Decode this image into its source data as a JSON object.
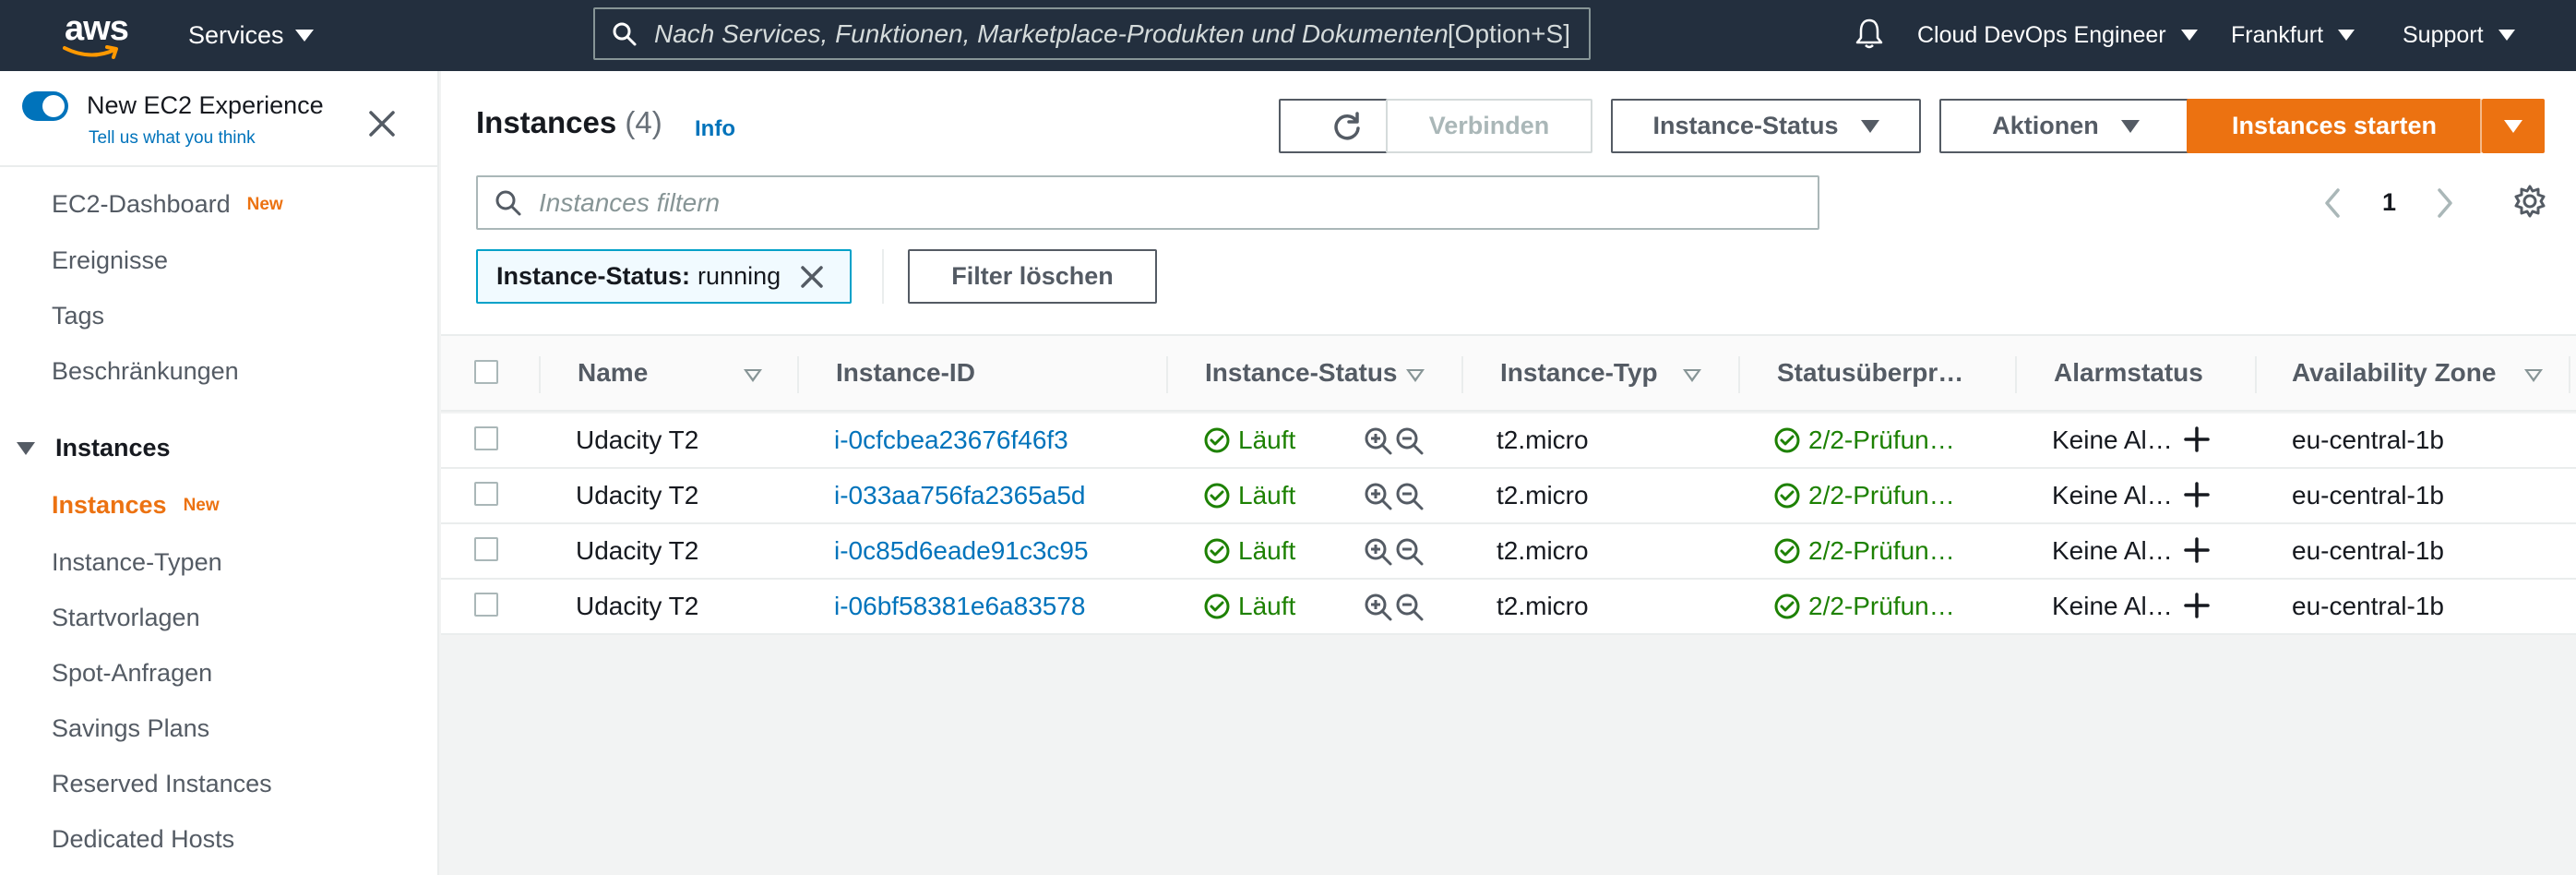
{
  "topnav": {
    "logo_text": "aws",
    "services_label": "Services",
    "search_placeholder": "Nach Services, Funktionen, Marketplace-Produkten und Dokumentenpfaden suchen",
    "search_shortcut": "[Option+S]",
    "account_label": "Cloud DevOps Engineer",
    "region_label": "Frankfurt",
    "support_label": "Support"
  },
  "sidebar": {
    "title": "New EC2 Experience",
    "feedback_link": "Tell us what you think",
    "items_top": [
      {
        "label": "EC2-Dashboard",
        "badge": "New"
      },
      {
        "label": "Ereignisse"
      },
      {
        "label": "Tags"
      },
      {
        "label": "Beschränkungen"
      }
    ],
    "section_title": "Instances",
    "items_section": [
      {
        "label": "Instances",
        "badge": "New",
        "active": true
      },
      {
        "label": "Instance-Typen"
      },
      {
        "label": "Startvorlagen"
      },
      {
        "label": "Spot-Anfragen"
      },
      {
        "label": "Savings Plans"
      },
      {
        "label": "Reserved Instances"
      },
      {
        "label": "Dedicated Hosts"
      }
    ]
  },
  "main": {
    "title": "Instances",
    "count": "(4)",
    "info_label": "Info",
    "connect_label": "Verbinden",
    "instance_state_label": "Instance-Status",
    "actions_label": "Aktionen",
    "launch_label": "Instances starten",
    "filter_placeholder": "Instances filtern",
    "page_number": "1",
    "filter_token": {
      "key": "Instance-Status:",
      "value": "running"
    },
    "clear_filter_label": "Filter löschen"
  },
  "table": {
    "columns": [
      "Name",
      "Instance-ID",
      "Instance-Status",
      "Instance-Typ",
      "Statusüberpr…",
      "Alarmstatus",
      "Availability Zone"
    ],
    "rows": [
      {
        "name": "Udacity T2",
        "id": "i-0cfcbea23676f46f3",
        "state": "Läuft",
        "type": "t2.micro",
        "check": "2/2-Prüfun…",
        "alarm": "Keine Al…",
        "az": "eu-central-1b"
      },
      {
        "name": "Udacity T2",
        "id": "i-033aa756fa2365a5d",
        "state": "Läuft",
        "type": "t2.micro",
        "check": "2/2-Prüfun…",
        "alarm": "Keine Al…",
        "az": "eu-central-1b"
      },
      {
        "name": "Udacity T2",
        "id": "i-0c85d6eade91c3c95",
        "state": "Läuft",
        "type": "t2.micro",
        "check": "2/2-Prüfun…",
        "alarm": "Keine Al…",
        "az": "eu-central-1b"
      },
      {
        "name": "Udacity T2",
        "id": "i-06bf58381e6a83578",
        "state": "Läuft",
        "type": "t2.micro",
        "check": "2/2-Prüfun…",
        "alarm": "Keine Al…",
        "az": "eu-central-1b"
      }
    ]
  },
  "colors": {
    "nav_bg": "#232f3e",
    "accent_orange": "#ec7211",
    "link_blue": "#0073bb",
    "success_green": "#1d8102"
  }
}
